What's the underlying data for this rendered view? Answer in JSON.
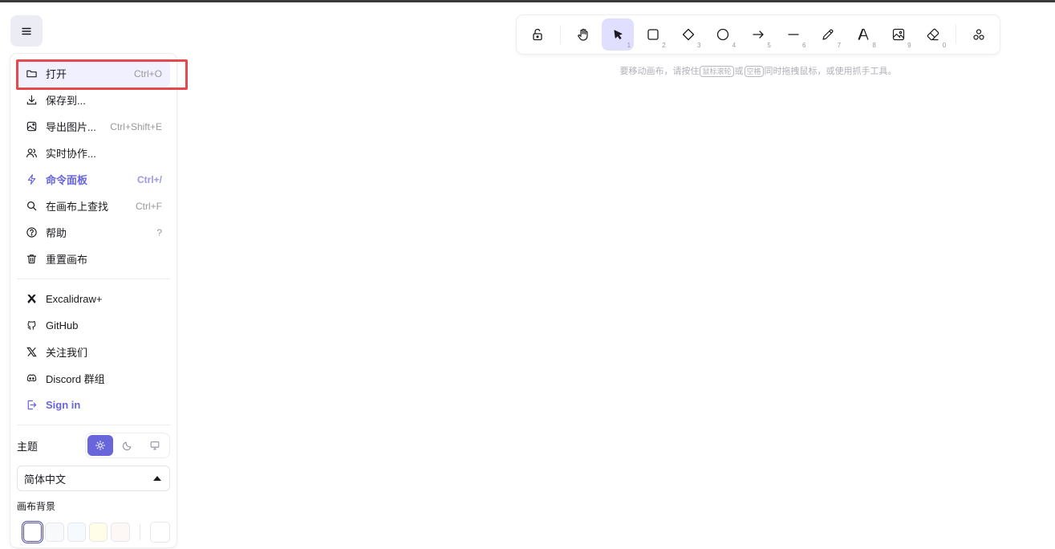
{
  "menu_button": {
    "icon": "hamburger-icon"
  },
  "menu": {
    "items": [
      {
        "label": "打开",
        "shortcut": "Ctrl+O",
        "icon": "folder-icon"
      },
      {
        "label": "保存到...",
        "shortcut": "",
        "icon": "download-icon"
      },
      {
        "label": "导出图片...",
        "shortcut": "Ctrl+Shift+E",
        "icon": "export-image-icon"
      },
      {
        "label": "实时协作...",
        "shortcut": "",
        "icon": "users-icon"
      },
      {
        "label": "命令面板",
        "shortcut": "Ctrl+/",
        "icon": "lightning-icon"
      },
      {
        "label": "在画布上查找",
        "shortcut": "Ctrl+F",
        "icon": "search-icon"
      },
      {
        "label": "帮助",
        "shortcut": "?",
        "icon": "help-icon"
      },
      {
        "label": "重置画布",
        "shortcut": "",
        "icon": "trash-icon"
      }
    ],
    "links": [
      {
        "label": "Excalidraw+",
        "icon": "excalidraw-plus-icon"
      },
      {
        "label": "GitHub",
        "icon": "github-icon"
      },
      {
        "label": "关注我们",
        "icon": "x-logo-icon"
      },
      {
        "label": "Discord 群组",
        "icon": "discord-icon"
      },
      {
        "label": "Sign in",
        "icon": "sign-in-icon"
      }
    ],
    "theme_label": "主题",
    "theme_options": [
      "light",
      "dark",
      "system"
    ],
    "theme_selected": "light",
    "language": "简体中文",
    "canvas_bg_label": "画布背景",
    "canvas_bg_colors": [
      "#ffffff",
      "#f8f9fa",
      "#f5faff",
      "#fffce8",
      "#fdf8f6"
    ],
    "canvas_bg_selected": "#ffffff",
    "canvas_bg_custom": "#ffffff"
  },
  "toolbar": {
    "tools": [
      {
        "name": "lock",
        "key": "",
        "icon": "unlock-icon"
      },
      {
        "name": "hand",
        "key": "",
        "icon": "hand-icon"
      },
      {
        "name": "selection",
        "key": "1",
        "icon": "pointer-icon",
        "selected": true
      },
      {
        "name": "rectangle",
        "key": "2",
        "icon": "rectangle-icon"
      },
      {
        "name": "diamond",
        "key": "3",
        "icon": "diamond-icon"
      },
      {
        "name": "ellipse",
        "key": "4",
        "icon": "circle-icon"
      },
      {
        "name": "arrow",
        "key": "5",
        "icon": "arrow-icon"
      },
      {
        "name": "line",
        "key": "6",
        "icon": "line-icon"
      },
      {
        "name": "draw",
        "key": "7",
        "icon": "pencil-icon"
      },
      {
        "name": "text",
        "key": "8",
        "icon": "text-icon"
      },
      {
        "name": "image",
        "key": "9",
        "icon": "image-icon"
      },
      {
        "name": "eraser",
        "key": "0",
        "icon": "eraser-icon"
      },
      {
        "name": "more",
        "key": "",
        "icon": "shapes-icon"
      }
    ]
  },
  "hint": {
    "part1": "要移动画布，请按住",
    "kbd1": "鼠标滚轮",
    "part2": "或",
    "kbd2": "空格",
    "part3": "同时拖拽鼠标，或使用抓手工具。"
  },
  "colors": {
    "accent": "#6965db",
    "selected_tool_bg": "#e0dfff",
    "highlight": "#e5484d"
  }
}
